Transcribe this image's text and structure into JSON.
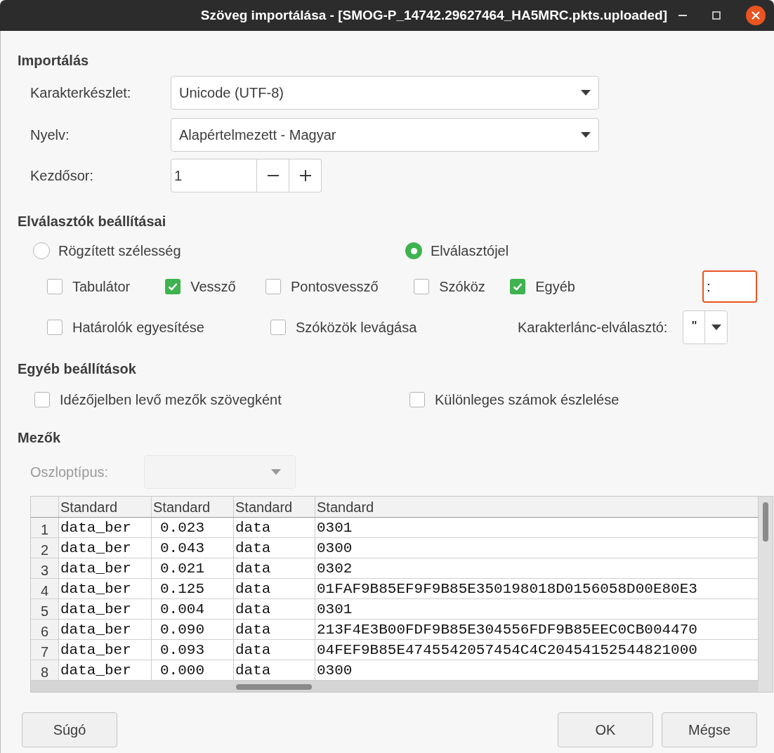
{
  "window": {
    "title": "Szöveg importálása - [SMOG-P_14742.29627464_HA5MRC.pkts.uploaded]"
  },
  "import": {
    "heading": "Importálás",
    "charset": {
      "label": "Karakterkészlet:",
      "value": "Unicode (UTF-8)"
    },
    "language": {
      "label": "Nyelv:",
      "value": "Alapértelmezett - Magyar"
    },
    "start_row": {
      "label": "Kezdősor:",
      "value": "1"
    }
  },
  "separator_options": {
    "heading": "Elválasztók beállításai",
    "modes": [
      {
        "label": "Rögzített szélesség",
        "selected": false
      },
      {
        "label": "Elválasztójel",
        "selected": true
      }
    ],
    "separators": [
      {
        "label": "Tabulátor",
        "checked": false
      },
      {
        "label": "Vessző",
        "checked": true
      },
      {
        "label": "Pontosvessző",
        "checked": false
      },
      {
        "label": "Szóköz",
        "checked": false
      },
      {
        "label": "Egyéb",
        "checked": true
      }
    ],
    "other_value": ":",
    "options": [
      {
        "label": "Határolók egyesítése",
        "checked": false
      },
      {
        "label": "Szóközök levágása",
        "checked": false
      }
    ],
    "string_delimiter": {
      "label": "Karakterlánc-elválasztó:",
      "value": "\""
    }
  },
  "other_options": {
    "heading": "Egyéb beállítások",
    "options": [
      {
        "label": "Idézőjelben levő mezők szövegként",
        "checked": false
      },
      {
        "label": "Különleges számok észlelése",
        "checked": false
      }
    ]
  },
  "fields": {
    "heading": "Mezők",
    "column_type": {
      "label": "Oszloptípus:",
      "disabled": true
    },
    "table": {
      "columns": [
        "Standard",
        "Standard",
        "Standard",
        "Standard"
      ],
      "rows": [
        {
          "number": "1",
          "cells": [
            "data_ber",
            "0.023",
            "data",
            "0301"
          ]
        },
        {
          "number": "2",
          "cells": [
            "data_ber",
            "0.043",
            "data",
            "0300"
          ]
        },
        {
          "number": "3",
          "cells": [
            "data_ber",
            "0.021",
            "data",
            "0302"
          ]
        },
        {
          "number": "4",
          "cells": [
            "data_ber",
            "0.125",
            "data",
            "01FAF9B85EF9F9B85E350198018D0156058D00E80E3"
          ]
        },
        {
          "number": "5",
          "cells": [
            "data_ber",
            "0.004",
            "data",
            "0301"
          ]
        },
        {
          "number": "6",
          "cells": [
            "data_ber",
            "0.090",
            "data",
            "213F4E3B00FDF9B85E304556FDF9B85EEC0CB004470"
          ]
        },
        {
          "number": "7",
          "cells": [
            "data_ber",
            "0.093",
            "data",
            "04FEF9B85E4745542057454C4C20454152544821000"
          ]
        },
        {
          "number": "8",
          "cells": [
            "data_ber",
            "0.000",
            "data",
            "0300"
          ]
        }
      ]
    }
  },
  "buttons": [
    "Súgó",
    "OK",
    "Mégse"
  ]
}
